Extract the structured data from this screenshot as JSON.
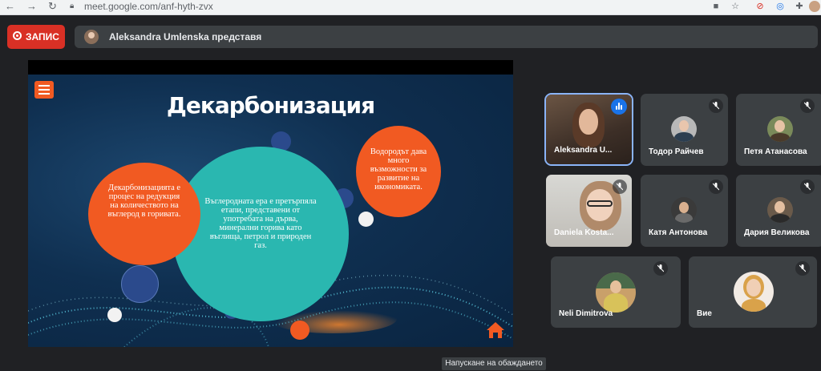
{
  "browser": {
    "url": "meet.google.com/anf-hyth-zvx"
  },
  "record": {
    "label": "ЗАПИС"
  },
  "presenter": {
    "text": "Aleksandra Umlenska представя"
  },
  "slide": {
    "title": "Декарбонизация",
    "left_circle": "Декарбонизацията е процес на редукция на количеството на въглерод в горивата.",
    "center_circle": "Въглеродната ера е претърпяла етапи, представени от употребата на дърва, минерални горива като въглища, петрол и природен газ.",
    "right_circle": "Водородът дава много възможности за развитие на икономиката.",
    "colors": {
      "orange": "#f15a22",
      "teal": "#2ab7b0",
      "navy": "#2b4a8c"
    }
  },
  "participants": [
    {
      "name": "Aleksandra U...",
      "state": "speaking"
    },
    {
      "name": "Тодор Райчев",
      "state": "muted"
    },
    {
      "name": "Петя Атанасова",
      "state": "muted"
    },
    {
      "name": "Daniela Kosta...",
      "state": "muted"
    },
    {
      "name": "Катя Антонова",
      "state": "muted"
    },
    {
      "name": "Дария Великова",
      "state": "muted"
    },
    {
      "name": "Neli Dimitrova",
      "state": "muted"
    },
    {
      "name": "Вие",
      "state": "muted"
    }
  ],
  "tooltip": "Напускане на обаждането"
}
